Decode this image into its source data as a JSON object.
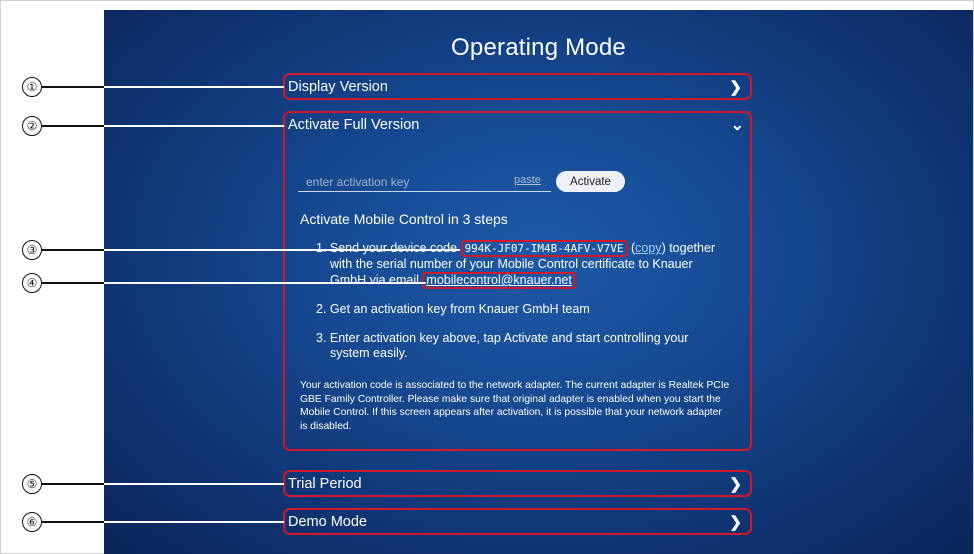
{
  "page": {
    "title": "Operating Mode"
  },
  "sections": {
    "display_version": {
      "label": "Display Version"
    },
    "activate_full_version": {
      "label": "Activate Full Version",
      "activation_input": {
        "placeholder": "enter activation key",
        "value": ""
      },
      "paste_label": "paste",
      "activate_button": "Activate",
      "steps_title": "Activate Mobile Control in 3 steps",
      "step1": {
        "prefix": "1. Send your device code",
        "code": "994K-JF07-IM4B-4AFV-V7VE",
        "copy": "copy",
        "line2": "with the serial number of your Mobile Control certificate to Knauer",
        "line3_prefix": "GmbH via email",
        "email": "mobilecontrol@knauer.net",
        "together": "together"
      },
      "step2": "2. Get an activation key from Knauer GmbH team",
      "step3_line1": "3. Enter activation key above, tap Activate and start controlling your",
      "step3_line2": "system easily.",
      "note": "Your activation code is associated to the network adapter. The current adapter is Realtek PCIe GBE Family Controller. Please make sure that original adapter is enabled when you start the Mobile Control. If this screen appears after activation, it is possible that your network adapter is disabled."
    },
    "trial_period": {
      "label": "Trial Period"
    },
    "demo_mode": {
      "label": "Demo Mode"
    }
  },
  "callouts": [
    "①",
    "②",
    "③",
    "④",
    "⑤",
    "⑥"
  ],
  "colors": {
    "highlight": "#d0182a",
    "background": "#164a92",
    "text": "#ffffff"
  },
  "icons": {
    "collapsed": "chevron-right-icon",
    "expanded": "chevron-down-icon"
  }
}
